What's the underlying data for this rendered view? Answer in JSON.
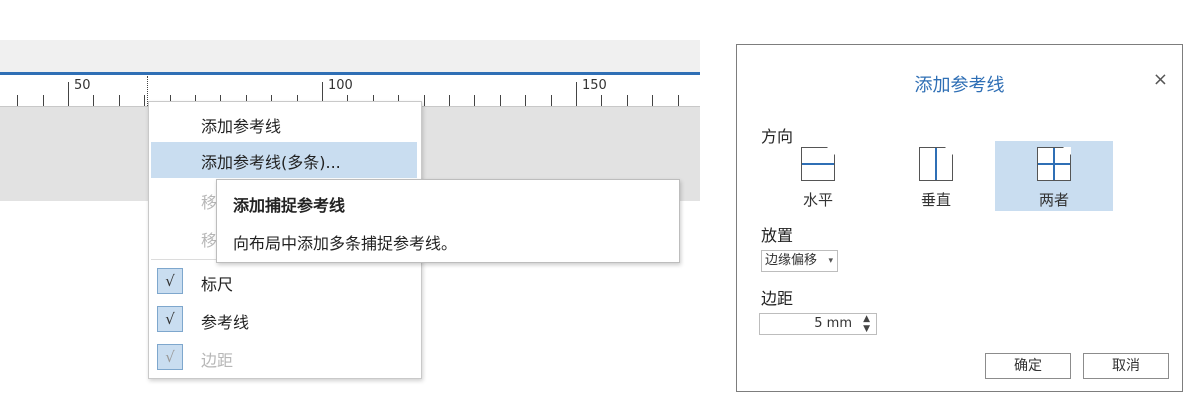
{
  "ruler": {
    "labels": [
      "50",
      "100",
      "150"
    ]
  },
  "context_menu": {
    "items": [
      {
        "label": "添加参考线",
        "state": "normal"
      },
      {
        "label": "添加参考线(多条)...",
        "state": "highlighted"
      },
      {
        "label": "移",
        "state": "disabled"
      },
      {
        "label": "移",
        "state": "disabled"
      }
    ],
    "toggles": [
      {
        "label": "标尺",
        "checked": true,
        "enabled": true
      },
      {
        "label": "参考线",
        "checked": true,
        "enabled": true
      },
      {
        "label": "边距",
        "checked": true,
        "enabled": false
      }
    ],
    "check_glyph": "√"
  },
  "tooltip": {
    "title": "添加捕捉参考线",
    "body": "向布局中添加多条捕捉参考线。"
  },
  "dialog": {
    "title": "添加参考线",
    "close_glyph": "×",
    "orientation_label": "方向",
    "orientations": [
      {
        "label": "水平",
        "icon": "horizontal-guide-icon"
      },
      {
        "label": "垂直",
        "icon": "vertical-guide-icon"
      },
      {
        "label": "两者",
        "icon": "both-guides-icon",
        "selected": true
      }
    ],
    "placement_label": "放置",
    "placement_value": "边缘偏移",
    "margin_label": "边距",
    "margin_value": "5 mm",
    "ok_label": "确定",
    "cancel_label": "取消"
  },
  "colors": {
    "accent": "#2f6fb5",
    "highlight": "#c9ddf0"
  }
}
